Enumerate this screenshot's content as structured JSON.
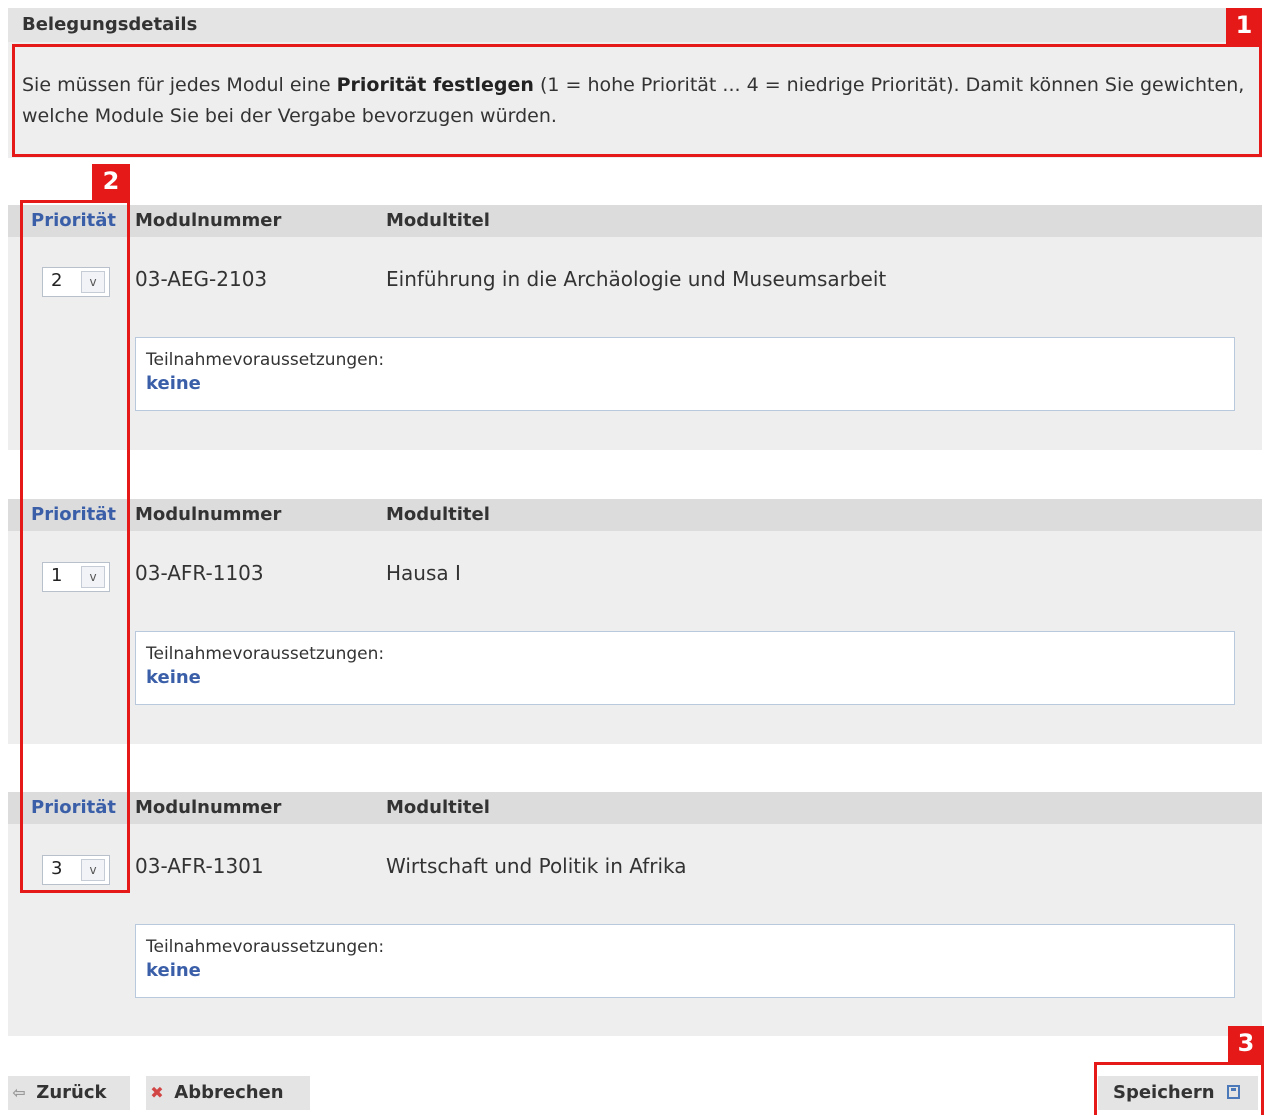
{
  "section": {
    "title": "Belegungsdetails"
  },
  "info": {
    "part1": "Sie müssen für jedes Modul eine ",
    "bold": "Priorität festlegen",
    "part2": " (1 = hohe Priorität ... 4 = niedrige Priorität). Damit können Sie gewichten, welche Module Sie bei der Vergabe bevorzugen würden."
  },
  "columns": {
    "priority": "Priorität",
    "number": "Modulnummer",
    "title": "Modultitel"
  },
  "modules": [
    {
      "priority": "2",
      "number": "03-AEG-2103",
      "title": "Einführung in die Archäologie und Museumsarbeit",
      "prereq_label": "Teilnahmevoraussetzungen:",
      "prereq_value": "keine"
    },
    {
      "priority": "1",
      "number": "03-AFR-1103",
      "title": "Hausa I",
      "prereq_label": "Teilnahmevoraussetzungen:",
      "prereq_value": "keine"
    },
    {
      "priority": "3",
      "number": "03-AFR-1301",
      "title": "Wirtschaft und Politik in Afrika",
      "prereq_label": "Teilnahmevoraussetzungen:",
      "prereq_value": "keine"
    }
  ],
  "buttons": {
    "back": "Zurück",
    "cancel": "Abbrechen",
    "save": "Speichern"
  },
  "annotations": {
    "one": "1",
    "two": "2",
    "three": "3",
    "color": "#e61919"
  },
  "icons": {
    "back": "arrow-left-icon",
    "cancel": "x-icon",
    "save": "floppy-disk-icon"
  }
}
